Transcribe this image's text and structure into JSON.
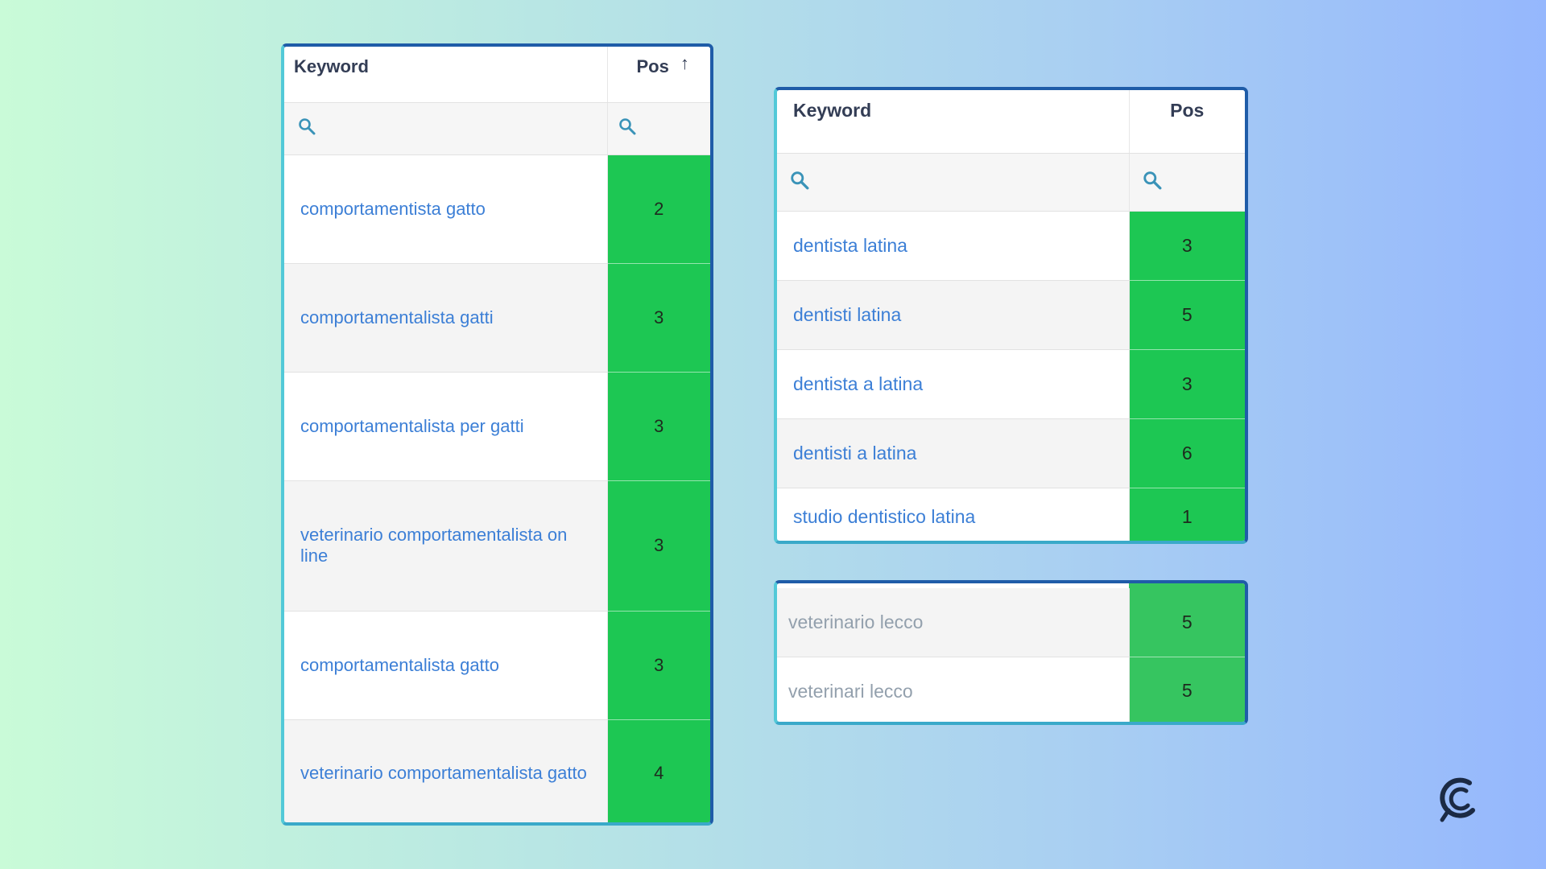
{
  "table_a": {
    "header_keyword": "Keyword",
    "header_pos": "Pos",
    "sort_indicator": "↑",
    "rows": [
      {
        "keyword": "comportamentista gatto",
        "pos": "2"
      },
      {
        "keyword": "comportamentalista gatti",
        "pos": "3"
      },
      {
        "keyword": "comportamentalista per gatti",
        "pos": "3"
      },
      {
        "keyword": "veterinario comportamentalista on line",
        "pos": "3"
      },
      {
        "keyword": "comportamentalista gatto",
        "pos": "3"
      },
      {
        "keyword": "veterinario comportamentalista gatto",
        "pos": "4"
      }
    ]
  },
  "table_b": {
    "header_keyword": "Keyword",
    "header_pos": "Pos",
    "rows": [
      {
        "keyword": "dentista latina",
        "pos": "3"
      },
      {
        "keyword": "dentisti latina",
        "pos": "5"
      },
      {
        "keyword": "dentista a latina",
        "pos": "3"
      },
      {
        "keyword": "dentisti a latina",
        "pos": "6"
      },
      {
        "keyword": "studio dentistico latina",
        "pos": "1"
      }
    ]
  },
  "table_c": {
    "rows": [
      {
        "keyword": "veterinario lecco",
        "pos": "5"
      },
      {
        "keyword": "veterinari lecco",
        "pos": "5"
      }
    ]
  },
  "icons": {
    "filter": "search-icon",
    "brand": "logo-icon"
  },
  "colors": {
    "pos_cell": "#1dc753",
    "keyword_link": "#3c7fd6",
    "panel_border": "#1f5ca8",
    "search_icon": "#3a93b8"
  }
}
